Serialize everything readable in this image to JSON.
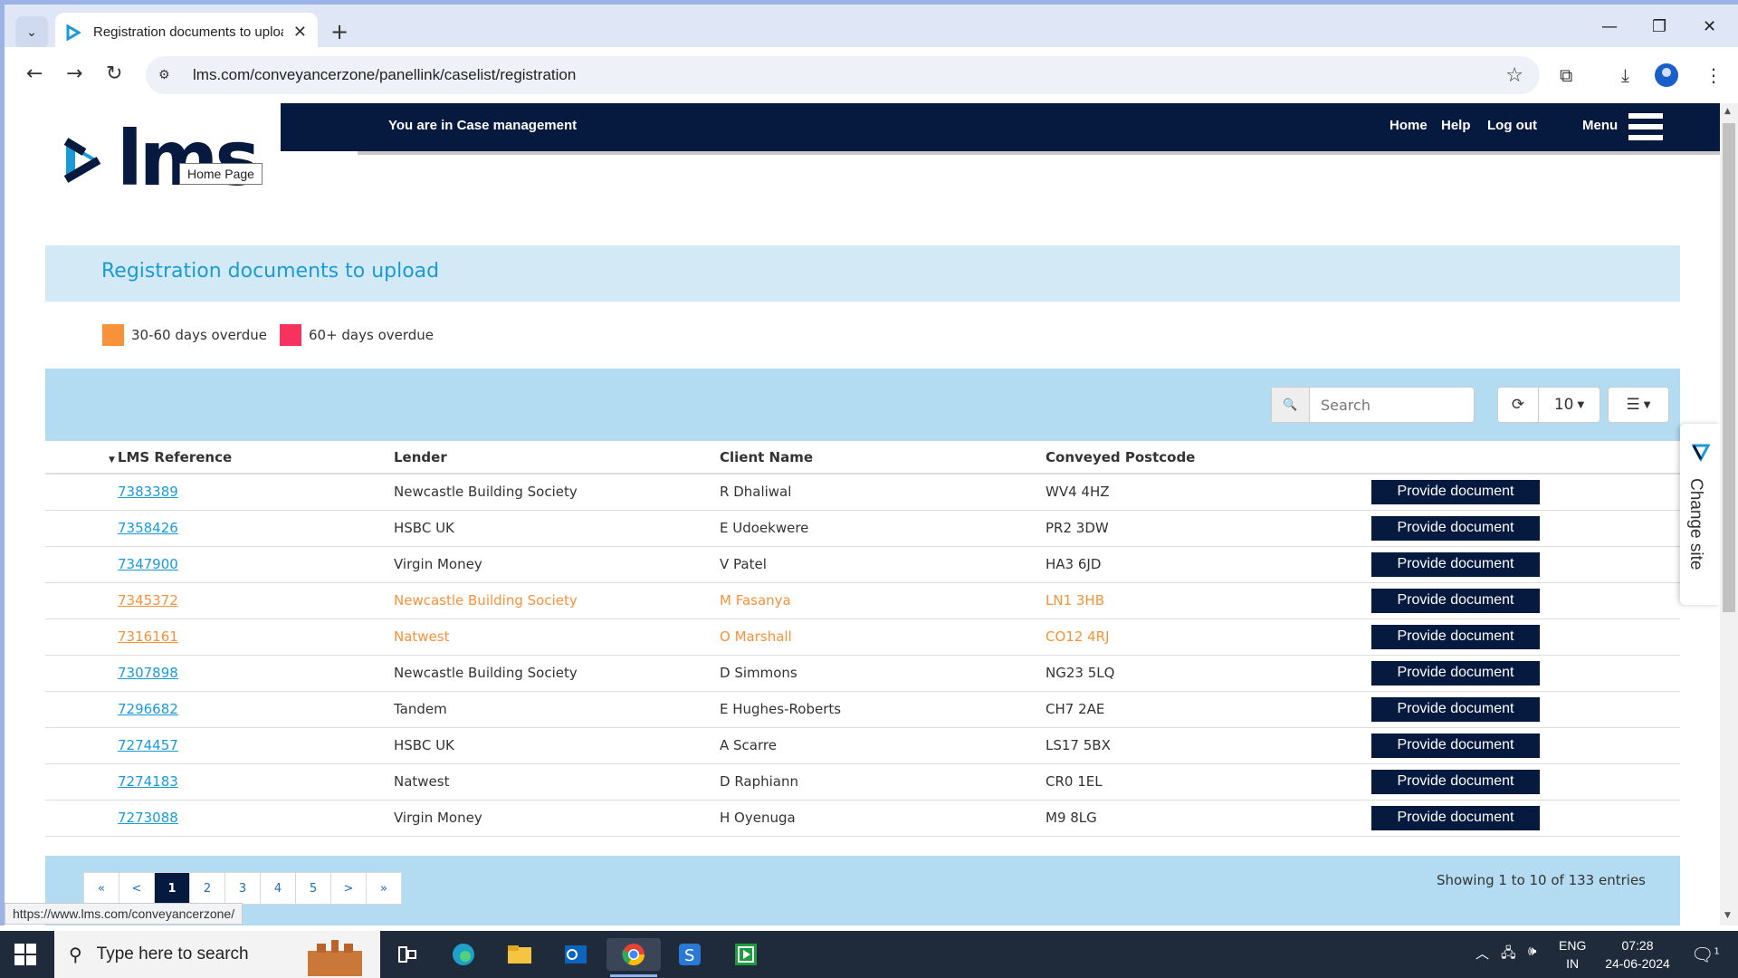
{
  "browser": {
    "tab_title": "Registration documents to upload",
    "url": "lms.com/conveyancerzone/panellink/caselist/registration",
    "status_url": "https://www.lms.com/conveyancerzone/"
  },
  "header": {
    "location_text": "You are in Case management",
    "nav": [
      "Home",
      "Help",
      "Log out",
      "Menu"
    ],
    "logo_text": "lms",
    "tooltip": "Home Page"
  },
  "page": {
    "title": "Registration documents to upload",
    "legend": [
      {
        "label": "30-60 days overdue",
        "color": "#f7923a"
      },
      {
        "label": "60+ days overdue",
        "color": "#f7325f"
      }
    ]
  },
  "toolbar": {
    "search_placeholder": "Search",
    "page_size": "10"
  },
  "table": {
    "columns": [
      "LMS Reference",
      "Lender",
      "Client Name",
      "Conveyed Postcode"
    ],
    "action_label": "Provide document",
    "rows": [
      {
        "ref": "7383389",
        "lender": "Newcastle Building Society",
        "client": "R Dhaliwal",
        "postcode": "WV4 4HZ",
        "status": "normal"
      },
      {
        "ref": "7358426",
        "lender": "HSBC UK",
        "client": "E Udoekwere",
        "postcode": "PR2 3DW",
        "status": "normal"
      },
      {
        "ref": "7347900",
        "lender": "Virgin Money",
        "client": "V Patel",
        "postcode": "HA3 6JD",
        "status": "normal"
      },
      {
        "ref": "7345372",
        "lender": "Newcastle Building Society",
        "client": "M Fasanya",
        "postcode": "LN1 3HB",
        "status": "orange"
      },
      {
        "ref": "7316161",
        "lender": "Natwest",
        "client": "O Marshall",
        "postcode": "CO12 4RJ",
        "status": "orange"
      },
      {
        "ref": "7307898",
        "lender": "Newcastle Building Society",
        "client": "D Simmons",
        "postcode": "NG23 5LQ",
        "status": "normal"
      },
      {
        "ref": "7296682",
        "lender": "Tandem",
        "client": "E Hughes-Roberts",
        "postcode": "CH7 2AE",
        "status": "normal"
      },
      {
        "ref": "7274457",
        "lender": "HSBC UK",
        "client": "A Scarre",
        "postcode": "LS17 5BX",
        "status": "normal"
      },
      {
        "ref": "7274183",
        "lender": "Natwest",
        "client": "D Raphiann",
        "postcode": "CR0 1EL",
        "status": "normal"
      },
      {
        "ref": "7273088",
        "lender": "Virgin Money",
        "client": "H Oyenuga",
        "postcode": "M9 8LG",
        "status": "normal"
      }
    ]
  },
  "pagination": {
    "first": "«",
    "prev": "<",
    "pages": [
      "1",
      "2",
      "3",
      "4",
      "5"
    ],
    "active": "1",
    "next": ">",
    "last": "»",
    "summary": "Showing 1 to 10 of 133 entries"
  },
  "side_tab": {
    "label": "Change site"
  },
  "taskbar": {
    "search_text": "Type here to search",
    "language": "ENG",
    "region": "IN",
    "time": "07:28",
    "date": "24-06-2024",
    "notification_count": "1"
  }
}
